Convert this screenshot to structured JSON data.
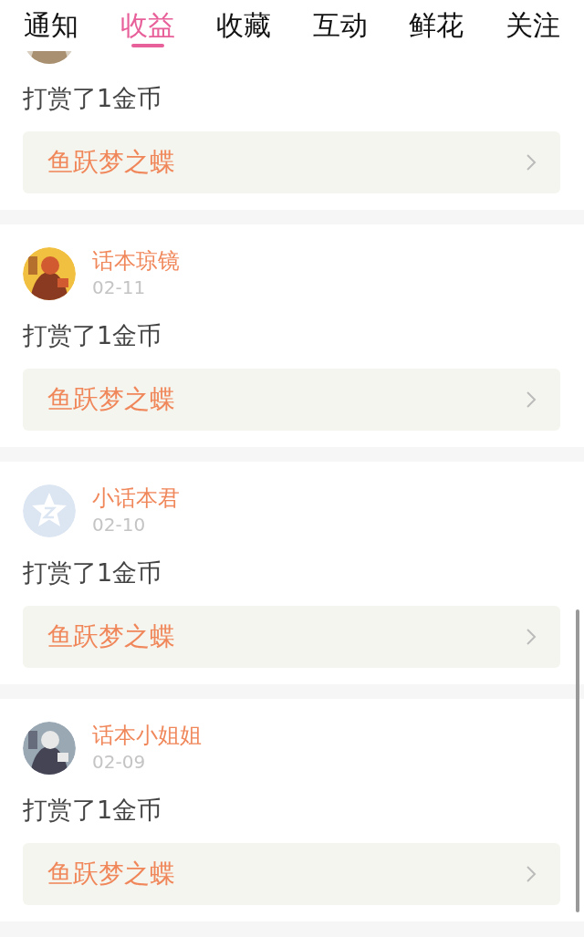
{
  "tabs": [
    {
      "label": "通知",
      "selected": false
    },
    {
      "label": "收益",
      "selected": true
    },
    {
      "label": "收藏",
      "selected": false
    },
    {
      "label": "互动",
      "selected": false
    },
    {
      "label": "鲜花",
      "selected": false
    },
    {
      "label": "关注",
      "selected": false
    }
  ],
  "items": [
    {
      "cut": true,
      "message": "打赏了1金币",
      "work": "鱼跃梦之蝶"
    },
    {
      "cut": false,
      "name": "话本琼镜",
      "date": "02-11",
      "message": "打赏了1金币",
      "work": "鱼跃梦之蝶"
    },
    {
      "cut": false,
      "avatar": {
        "kind": "default"
      },
      "name": "小话本君",
      "date": "02-10",
      "message": "打赏了1金币",
      "work": "鱼跃梦之蝶"
    },
    {
      "cut": false,
      "name": "话本小姐姐",
      "date": "02-09",
      "message": "打赏了1金币",
      "work": "鱼跃梦之蝶"
    }
  ]
}
